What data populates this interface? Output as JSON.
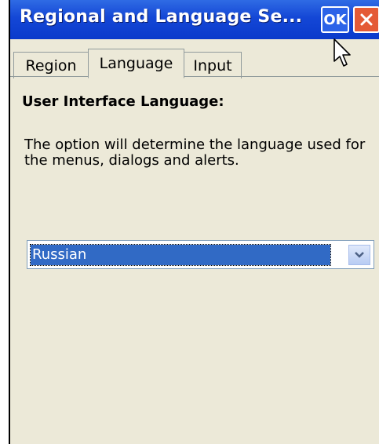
{
  "window": {
    "title": "Regional and Language Se...",
    "ok_label": "OK"
  },
  "tabs": [
    {
      "label": "Region"
    },
    {
      "label": "Language"
    },
    {
      "label": "Input"
    }
  ],
  "language_tab": {
    "heading": "User Interface Language:",
    "description": "The option will determine the language used for the menus, dialogs and alerts.",
    "selected_language": "Russian"
  },
  "colors": {
    "titlebar": "#0A3ACB",
    "selection": "#316AC5",
    "window_bg": "#ECE9D8",
    "close": "#E45A36"
  }
}
